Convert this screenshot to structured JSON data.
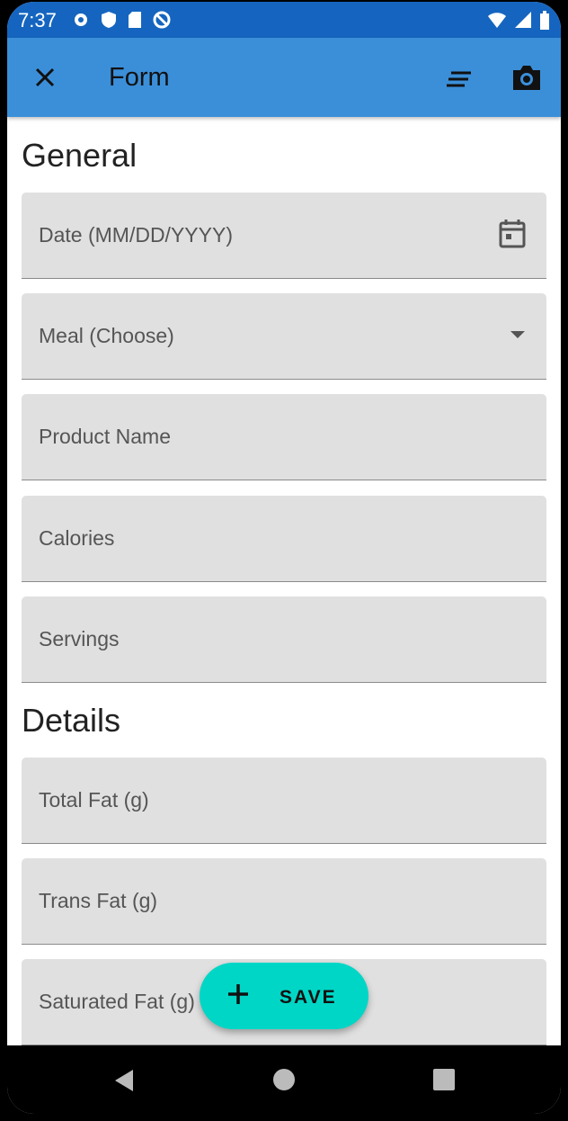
{
  "status_bar": {
    "time": "7:37",
    "left_icons": [
      "settings-icon",
      "shield-icon",
      "sd-card-icon",
      "do-not-disturb-icon"
    ],
    "right_icons": [
      "wifi-icon",
      "signal-icon",
      "battery-icon"
    ]
  },
  "app_bar": {
    "title": "Form",
    "color": "#3b8fd9",
    "actions": [
      "close-icon",
      "notes-icon",
      "camera-icon"
    ]
  },
  "sections": {
    "general": {
      "title": "General",
      "fields": [
        {
          "label": "Date (MM/DD/YYYY)",
          "icon": "calendar-icon"
        },
        {
          "label": "Meal (Choose)",
          "icon": "dropdown-arrow-icon"
        },
        {
          "label": "Product Name"
        },
        {
          "label": "Calories"
        },
        {
          "label": "Servings"
        }
      ]
    },
    "details": {
      "title": "Details",
      "fields": [
        {
          "label": "Total Fat (g)"
        },
        {
          "label": "Trans Fat (g)"
        },
        {
          "label": "Saturated Fat (g)"
        }
      ]
    }
  },
  "fab": {
    "label": "SAVE",
    "icon": "plus-icon",
    "color": "#00d6c6"
  },
  "nav_bar": {
    "buttons": [
      "back-icon",
      "home-icon",
      "recents-icon"
    ]
  }
}
